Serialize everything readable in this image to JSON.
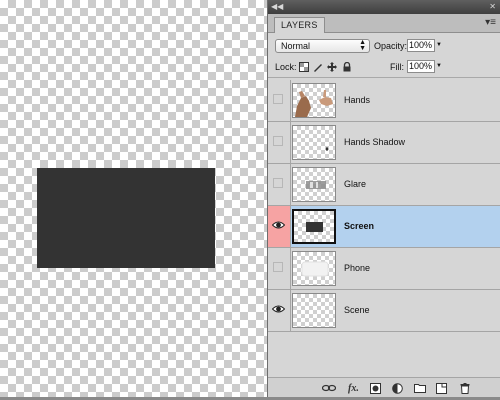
{
  "panel": {
    "tab_label": "LAYERS",
    "blend_mode": "Normal",
    "opacity_label": "Opacity:",
    "opacity_value": "100%",
    "lock_label": "Lock:",
    "fill_label": "Fill:",
    "fill_value": "100%",
    "collapse_icon": "double-chevron-left",
    "menu_icon": "panel-menu"
  },
  "layers": [
    {
      "name": "Hands",
      "visible": false,
      "selected": false
    },
    {
      "name": "Hands Shadow",
      "visible": false,
      "selected": false
    },
    {
      "name": "Glare",
      "visible": false,
      "selected": false
    },
    {
      "name": "Screen",
      "visible": true,
      "selected": true
    },
    {
      "name": "Phone",
      "visible": false,
      "selected": false
    },
    {
      "name": "Scene",
      "visible": true,
      "selected": false
    }
  ],
  "bottom_icons": [
    "link-icon",
    "fx-icon",
    "mask-icon",
    "adjustment-icon",
    "group-folder-icon",
    "new-layer-icon",
    "trash-icon"
  ],
  "colors": {
    "selected_row": "#b3d1ee",
    "visibility_highlight": "#f6a3a3",
    "screen_fill": "#333333"
  }
}
